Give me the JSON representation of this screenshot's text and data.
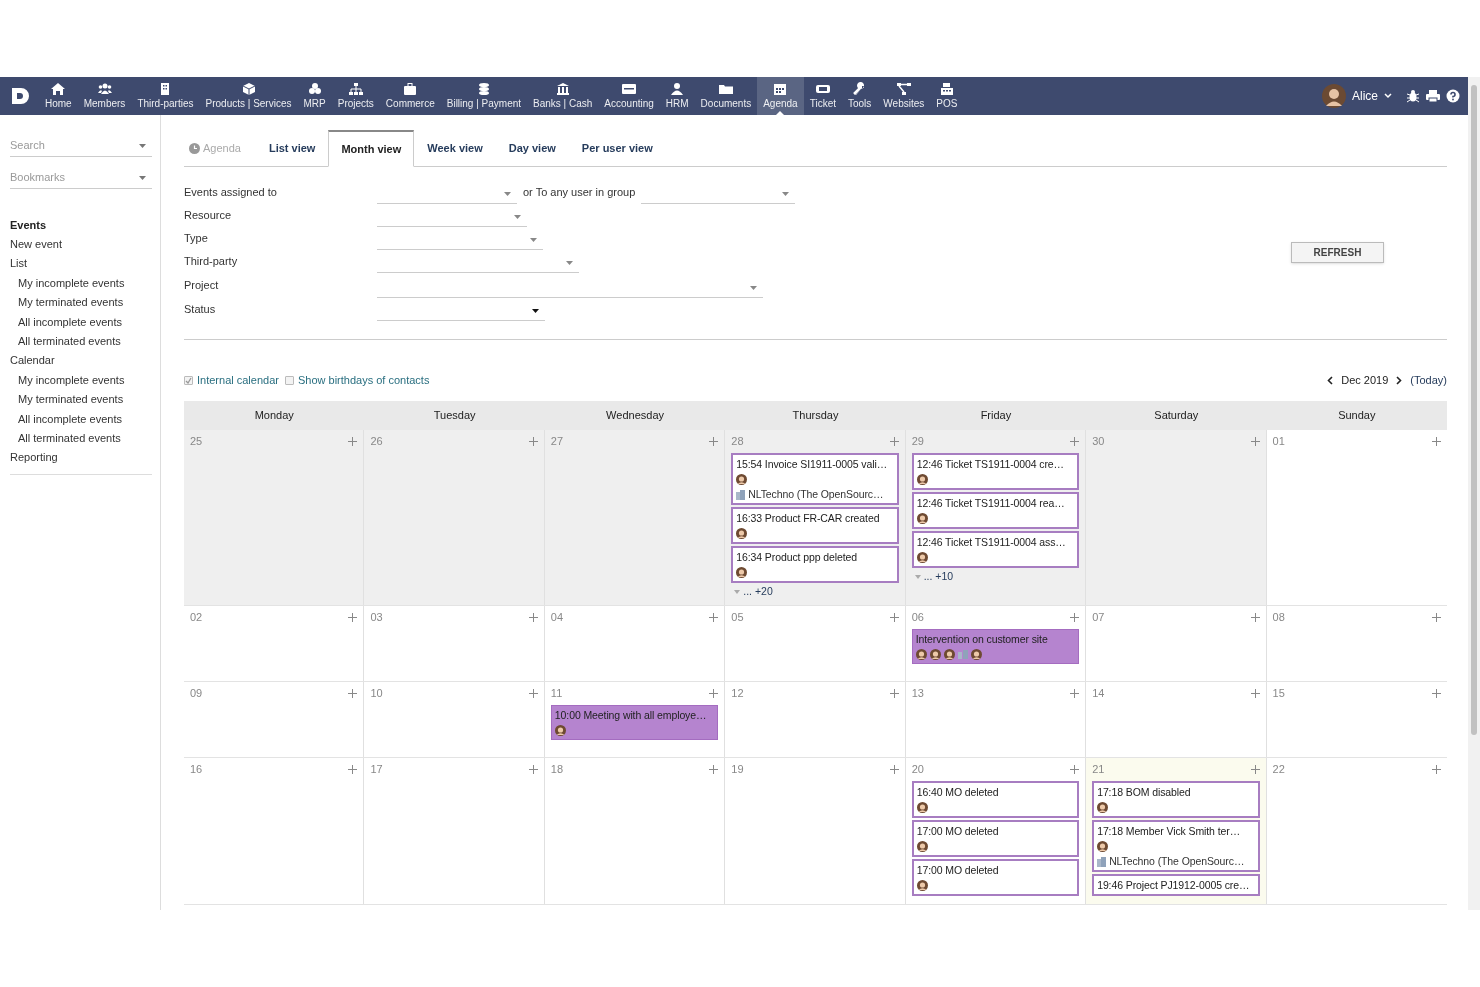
{
  "nav": {
    "items": [
      {
        "label": "Home",
        "selected": false
      },
      {
        "label": "Members",
        "selected": false
      },
      {
        "label": "Third-parties",
        "selected": false
      },
      {
        "label": "Products | Services",
        "selected": false
      },
      {
        "label": "MRP",
        "selected": false
      },
      {
        "label": "Projects",
        "selected": false
      },
      {
        "label": "Commerce",
        "selected": false
      },
      {
        "label": "Billing | Payment",
        "selected": false
      },
      {
        "label": "Banks | Cash",
        "selected": false
      },
      {
        "label": "Accounting",
        "selected": false
      },
      {
        "label": "HRM",
        "selected": false
      },
      {
        "label": "Documents",
        "selected": false
      },
      {
        "label": "Agenda",
        "selected": true
      },
      {
        "label": "Ticket",
        "selected": false
      },
      {
        "label": "Tools",
        "selected": false
      },
      {
        "label": "Websites",
        "selected": false
      },
      {
        "label": "POS",
        "selected": false
      }
    ],
    "user": "Alice"
  },
  "sidebar": {
    "search": {
      "placeholder": "Search"
    },
    "bookmarks": {
      "placeholder": "Bookmarks"
    },
    "title": "Events",
    "items": [
      {
        "label": "New event"
      },
      {
        "label": "List",
        "children": [
          {
            "label": "My incomplete events"
          },
          {
            "label": "My terminated events"
          },
          {
            "label": "All incomplete events"
          },
          {
            "label": "All terminated events"
          }
        ]
      },
      {
        "label": "Calendar",
        "children": [
          {
            "label": "My incomplete events"
          },
          {
            "label": "My terminated events"
          },
          {
            "label": "All incomplete events"
          },
          {
            "label": "All terminated events"
          }
        ]
      },
      {
        "label": "Reporting"
      }
    ]
  },
  "page_title": "Agenda",
  "tabs": [
    {
      "label": "List view",
      "selected": false
    },
    {
      "label": "Month view",
      "selected": true
    },
    {
      "label": "Week view",
      "selected": false
    },
    {
      "label": "Day view",
      "selected": false
    },
    {
      "label": "Per user view",
      "selected": false
    }
  ],
  "filters": [
    {
      "label": "Events assigned to",
      "group_label": "or To any user in group"
    },
    {
      "label": "Resource"
    },
    {
      "label": "Type"
    },
    {
      "label": "Third-party"
    },
    {
      "label": "Project"
    },
    {
      "label": "Status"
    }
  ],
  "refresh_button": "REFRESH",
  "options": [
    {
      "label": "Internal calendar",
      "checked": true
    },
    {
      "label": "Show birthdays of contacts",
      "checked": false
    }
  ],
  "month": "Dec 2019",
  "today_link": "(Today)",
  "weekdays": [
    "Monday",
    "Tuesday",
    "Wednesday",
    "Thursday",
    "Friday",
    "Saturday",
    "Sunday"
  ],
  "weeks": [
    [
      {
        "day": "25",
        "muted": true
      },
      {
        "day": "26",
        "muted": true
      },
      {
        "day": "27",
        "muted": true
      },
      {
        "day": "28",
        "muted": true,
        "events": [
          {
            "kind": "outlined",
            "title": "15:54 Invoice SI1911-0005 vali…",
            "attendees": [
              {
                "kind": "user"
              }
            ],
            "thirdparty": "NLTechno (The OpenSourc…"
          },
          {
            "kind": "outlined",
            "title": "16:33 Product FR-CAR created",
            "attendees": [
              {
                "kind": "user"
              }
            ]
          },
          {
            "kind": "outlined",
            "title": "16:34 Product ppp deleted",
            "attendees": [
              {
                "kind": "user"
              }
            ]
          }
        ],
        "more": "... +20"
      },
      {
        "day": "29",
        "muted": true,
        "events": [
          {
            "kind": "outlined",
            "title": "12:46 Ticket TS1911-0004 cre…",
            "attendees": [
              {
                "kind": "user"
              }
            ]
          },
          {
            "kind": "outlined",
            "title": "12:46 Ticket TS1911-0004 rea…",
            "attendees": [
              {
                "kind": "user"
              }
            ]
          },
          {
            "kind": "outlined",
            "title": "12:46 Ticket TS1911-0004 ass…",
            "attendees": [
              {
                "kind": "user"
              }
            ]
          }
        ],
        "more": "... +10"
      },
      {
        "day": "30",
        "muted": true
      },
      {
        "day": "01"
      }
    ],
    [
      {
        "day": "02"
      },
      {
        "day": "03"
      },
      {
        "day": "04"
      },
      {
        "day": "05"
      },
      {
        "day": "06",
        "events": [
          {
            "kind": "filled",
            "title": "Intervention on customer site",
            "attendees": [
              {
                "kind": "user"
              },
              {
                "kind": "user"
              },
              {
                "kind": "user"
              },
              {
                "kind": "group"
              },
              {
                "kind": "user"
              }
            ]
          }
        ]
      },
      {
        "day": "07"
      },
      {
        "day": "08"
      }
    ],
    [
      {
        "day": "09"
      },
      {
        "day": "10"
      },
      {
        "day": "11",
        "events": [
          {
            "kind": "filled",
            "title": "10:00 Meeting with all employe…",
            "attendees": [
              {
                "kind": "user"
              }
            ]
          }
        ]
      },
      {
        "day": "12"
      },
      {
        "day": "13"
      },
      {
        "day": "14"
      },
      {
        "day": "15"
      }
    ],
    [
      {
        "day": "16"
      },
      {
        "day": "17"
      },
      {
        "day": "18"
      },
      {
        "day": "19"
      },
      {
        "day": "20",
        "events": [
          {
            "kind": "outlined",
            "title": "16:40 MO deleted",
            "attendees": [
              {
                "kind": "user"
              }
            ]
          },
          {
            "kind": "outlined",
            "title": "17:00 MO deleted",
            "attendees": [
              {
                "kind": "user"
              }
            ]
          },
          {
            "kind": "outlined",
            "title": "17:00 MO deleted",
            "attendees": [
              {
                "kind": "user"
              }
            ]
          }
        ]
      },
      {
        "day": "21",
        "today": true,
        "events": [
          {
            "kind": "outlined",
            "title": "17:18 BOM disabled",
            "attendees": [
              {
                "kind": "user"
              }
            ]
          },
          {
            "kind": "outlined",
            "title": "17:18 Member Vick Smith ter…",
            "attendees": [
              {
                "kind": "user"
              }
            ],
            "thirdparty": "NLTechno (The OpenSourc…"
          },
          {
            "kind": "outlined",
            "title": "19:46 Project PJ1912-0005 cre…"
          }
        ]
      },
      {
        "day": "22"
      }
    ]
  ]
}
